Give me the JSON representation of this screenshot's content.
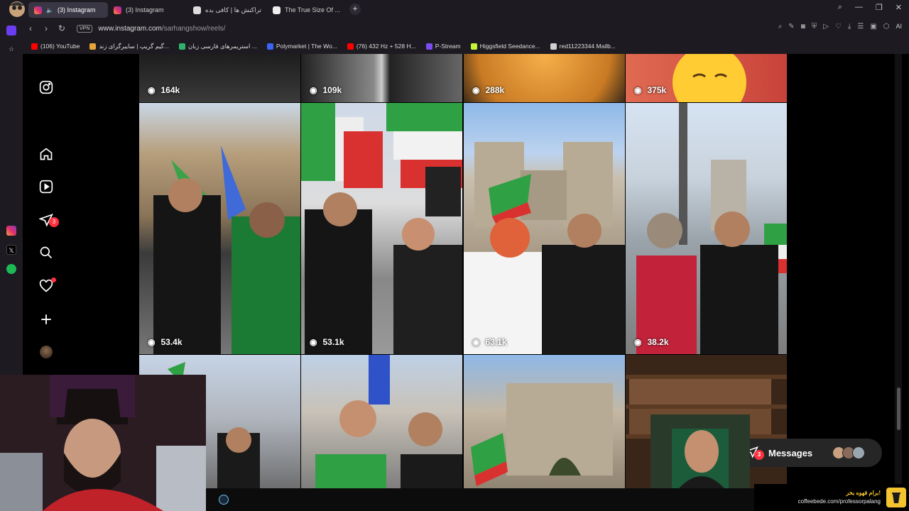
{
  "browser": {
    "tabs": [
      {
        "title": "(3) Instagram",
        "favicon": "instagram-icon",
        "active": true,
        "muted": true
      },
      {
        "title": "(3) Instagram",
        "favicon": "instagram-icon",
        "active": false
      },
      {
        "title": "تراکنش ها | کافی بده",
        "favicon": "coffeebede-icon",
        "active": false
      },
      {
        "title": "The True Size Of ...",
        "favicon": "page-icon",
        "active": false
      }
    ],
    "vpn_label": "VPN",
    "url_host": "www.instagram.com",
    "url_path": "/sarhangshow/reels/",
    "ai_label": "AI",
    "bookmarks": [
      {
        "label": "(106) YouTube",
        "color": "#ff0000"
      },
      {
        "label": "گیم گریپ | سایبرگرای زند...",
        "color": "#e8a33a"
      },
      {
        "label": "استریمرهای فارسی زبان ...",
        "color": "#2fb36b"
      },
      {
        "label": "Polymarket | The Wo...",
        "color": "#3b63f5"
      },
      {
        "label": "(76) 432 Hz + 528 H...",
        "color": "#ff0000"
      },
      {
        "label": "P-Stream",
        "color": "#7b4df0"
      },
      {
        "label": "Higgsfield Seedance...",
        "color": "#c7f23a"
      },
      {
        "label": "red11223344 Mailb...",
        "color": "#d0d0d0"
      }
    ]
  },
  "instagram": {
    "notification_count": "3",
    "messages_label": "Messages",
    "messages_badge": "3",
    "reels": [
      {
        "views": "164k"
      },
      {
        "views": "109k"
      },
      {
        "views": "288k"
      },
      {
        "views": "375k"
      },
      {
        "views": "53.4k"
      },
      {
        "views": "53.1k"
      },
      {
        "views": "63.1k"
      },
      {
        "views": "38.2k"
      },
      {
        "views": ""
      },
      {
        "views": ""
      },
      {
        "views": ""
      },
      {
        "views": ""
      }
    ]
  },
  "overlay": {
    "coffee_top": "برام قهوه بخر!",
    "coffee_url": "coffeebede.com/professorpalang"
  }
}
